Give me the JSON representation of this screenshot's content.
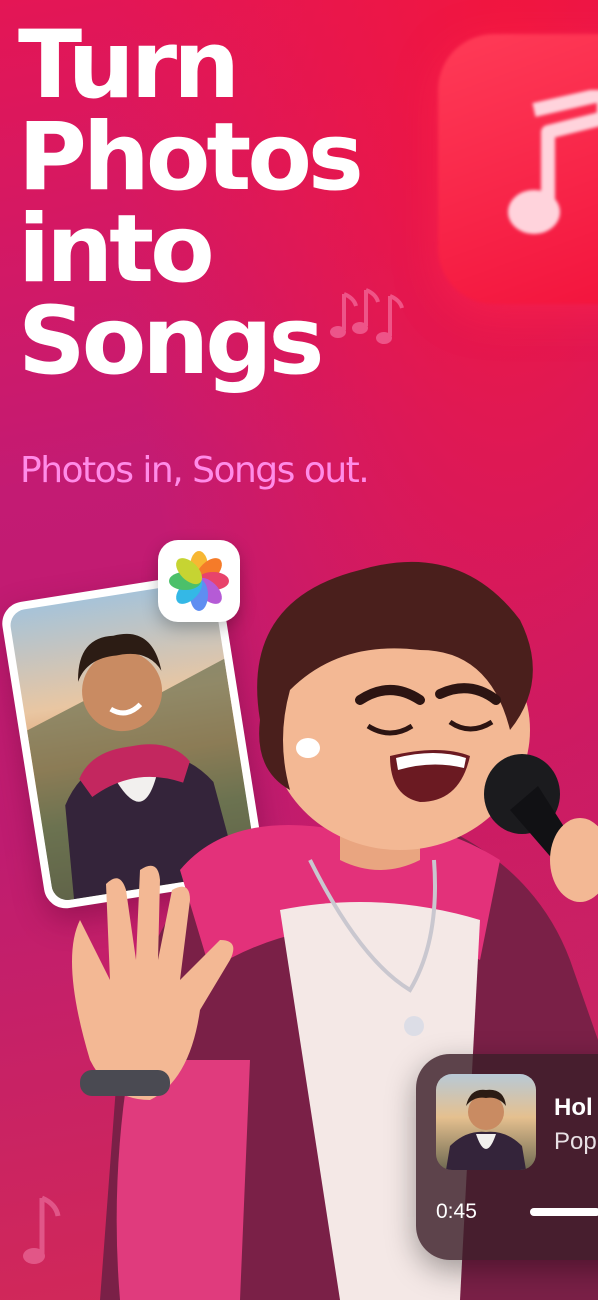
{
  "headline": {
    "lines": [
      "Turn",
      "Photos",
      "into",
      "Songs"
    ]
  },
  "tagline": "Photos in, Songs out.",
  "player": {
    "title": "Hol",
    "genre": "Pop",
    "time": "0:45",
    "progress": 0.35
  },
  "icons": {
    "music_app": "music-note-icon",
    "photos_app": "photos-flower-icon"
  },
  "colors": {
    "background": "#c31b73",
    "accent": "#f2163f",
    "tagline": "#ff8ce8"
  }
}
